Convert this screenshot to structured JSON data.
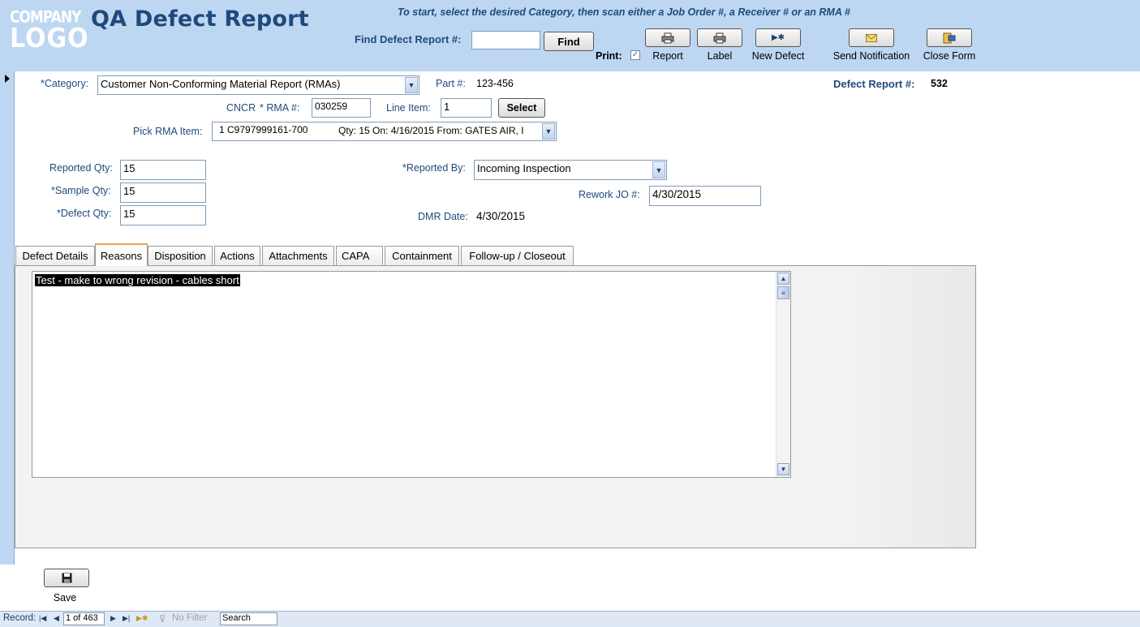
{
  "header": {
    "logo_line1": "COMPANY",
    "logo_line2": "LOGO",
    "title": "QA Defect Report",
    "instruction": "To start, select the desired Category, then scan either a Job Order #, a Receiver # or an RMA #",
    "find_label": "Find Defect Report #:",
    "find_value": "",
    "find_button": "Find",
    "print_label": "Print:",
    "toolbar": {
      "report_label": "Report",
      "label_label": "Label",
      "new_defect_label": "New Defect",
      "send_notification_label": "Send Notification",
      "close_form_label": "Close Form"
    }
  },
  "form": {
    "category_label": "*Category:",
    "category_value": "Customer Non-Conforming Material Report (RMAs)",
    "part_label": "Part #:",
    "part_value": "123-456",
    "defect_report_label": "Defect Report #:",
    "defect_report_value": "532",
    "cncr_label": "CNCR",
    "rma_label": "* RMA #:",
    "rma_value": "030259",
    "line_item_label": "Line Item:",
    "line_item_value": "1",
    "select_button": "Select",
    "pick_rma_label": "Pick RMA Item:",
    "pick_rma_value": "1 C9797999161-700",
    "pick_rma_detail": "Qty: 15 On: 4/16/2015 From: GATES AIR, I",
    "reported_qty_label": "Reported Qty:",
    "reported_qty_value": "15",
    "sample_qty_label": "*Sample Qty:",
    "sample_qty_value": "15",
    "defect_qty_label": "*Defect Qty:",
    "defect_qty_value": "15",
    "reported_by_label": "*Reported By:",
    "reported_by_value": "Incoming Inspection",
    "rework_jo_label": "Rework JO #:",
    "rework_jo_value": "4/30/2015",
    "dmr_date_label": "DMR Date:",
    "dmr_date_value": "4/30/2015"
  },
  "tabs": [
    {
      "label": "Defect Details"
    },
    {
      "label": "Reasons"
    },
    {
      "label": "Disposition"
    },
    {
      "label": "Actions"
    },
    {
      "label": "Attachments"
    },
    {
      "label": "CAPA"
    },
    {
      "label": "Containment"
    },
    {
      "label": "Follow-up / Closeout"
    }
  ],
  "active_tab": "Reasons",
  "reasons_text": "Test - make to wrong revision - cables short",
  "save_label": "Save",
  "statusbar": {
    "record_label": "Record:",
    "record_position": "1 of 463",
    "filter_label": "No Filter",
    "search_label": "Search"
  },
  "colors": {
    "header_bg": "#bdd7f2",
    "title_color": "#1f497d",
    "active_tab_accent": "#e8a24a"
  },
  "icons": {
    "report": "printer-icon",
    "label": "printer-icon",
    "new_defect": "new-record-icon",
    "send_notification": "envelope-icon",
    "close_form": "close-form-icon",
    "save": "floppy-disk-icon"
  }
}
